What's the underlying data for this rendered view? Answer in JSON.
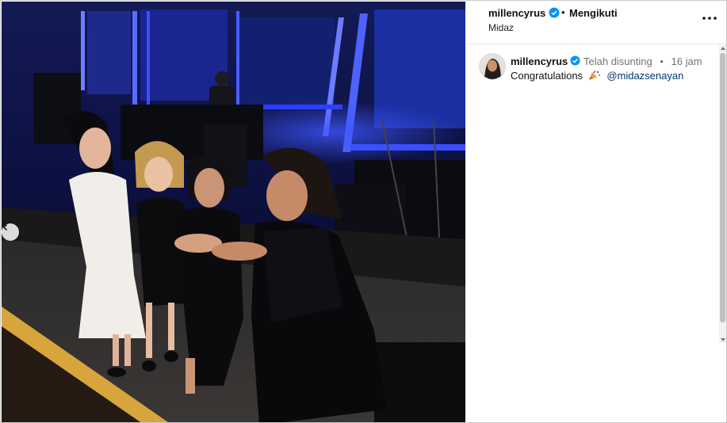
{
  "post_header": {
    "username": "millencyrus",
    "separator": "•",
    "follow_label": "Mengikuti",
    "location": "Midaz"
  },
  "comment": {
    "username": "millencyrus",
    "edited_label": "Telah disunting",
    "separator": "•",
    "time_ago": "16 jam",
    "text": "Congratulations",
    "emoji": "party-popper",
    "mention": "@midazsenayan"
  },
  "icons": {
    "verified": "verified-badge-icon",
    "more": "more-options-icon",
    "carousel_prev": "chevron-left-icon"
  },
  "colors": {
    "verified": "#0095f6",
    "mention": "#00376b",
    "meta_text": "#737373",
    "stage_light": "#2a3cff"
  }
}
